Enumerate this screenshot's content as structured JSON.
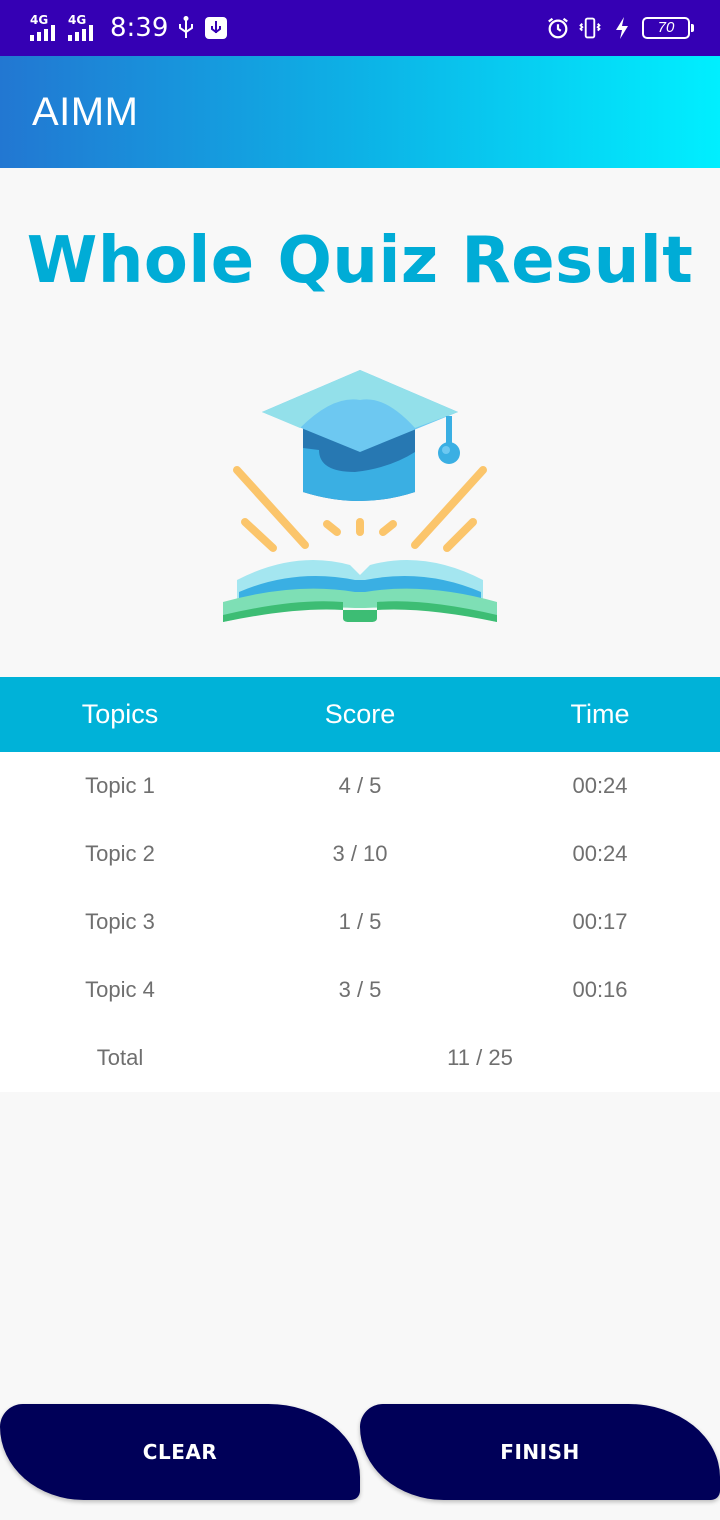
{
  "status_bar": {
    "network1": "4G",
    "network2": "4G",
    "time": "8:39",
    "battery": "70"
  },
  "app_bar": {
    "title": "AIMM"
  },
  "page": {
    "title": "Whole Quiz Result"
  },
  "table": {
    "headers": [
      "Topics",
      "Score",
      "Time"
    ],
    "rows": [
      {
        "topic": "Topic 1",
        "score": "4 / 5",
        "time": "00:24"
      },
      {
        "topic": "Topic 2",
        "score": "3 / 10",
        "time": "00:24"
      },
      {
        "topic": "Topic 3",
        "score": "1 / 5",
        "time": "00:17"
      },
      {
        "topic": "Topic 4",
        "score": "3 / 5",
        "time": "00:16"
      }
    ],
    "total": {
      "label": "Total",
      "score": "11 / 25"
    }
  },
  "buttons": {
    "clear": "CLEAR",
    "finish": "FINISH"
  },
  "colors": {
    "status_bar": "#3500b4",
    "title": "#00acd6",
    "table_header": "#00b2d8",
    "button": "#000058"
  },
  "illustration": {
    "icon": "graduation-cap-and-open-book-icon"
  }
}
